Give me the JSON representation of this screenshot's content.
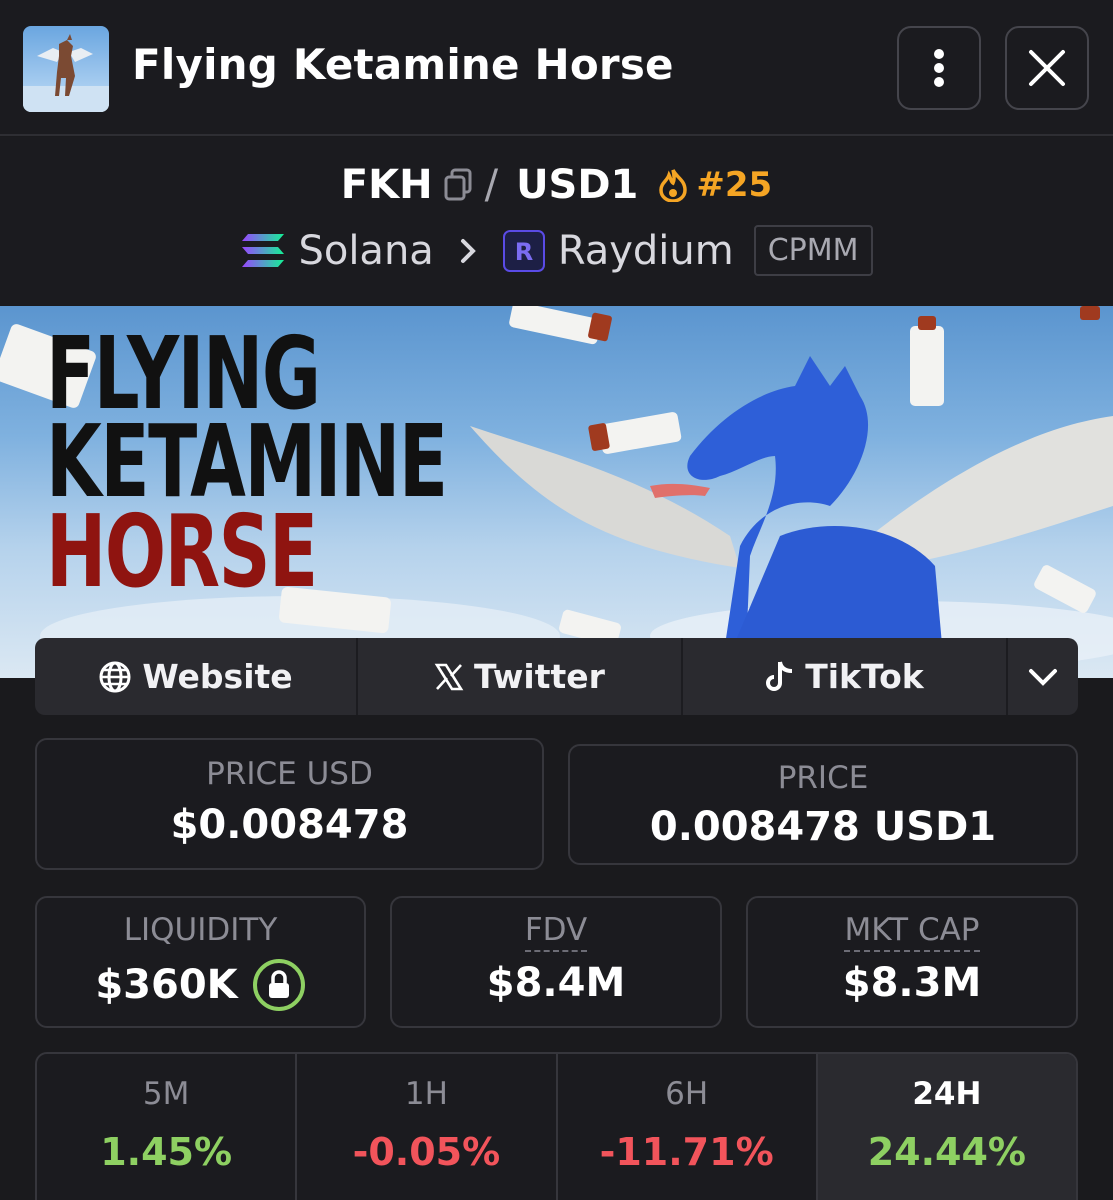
{
  "header": {
    "title": "Flying Ketamine Horse",
    "avatar_icon": "flying-horse-avatar",
    "more_icon": "vertical-dots-icon",
    "close_icon": "close-icon"
  },
  "pair": {
    "base": "FKH",
    "quote": "USD1",
    "rank": "#25",
    "chain": "Solana",
    "dex": "Raydium",
    "pool_type": "CPMM",
    "accent_color": "#f5a524"
  },
  "banner": {
    "line1": "FLYING",
    "line2": "KETAMINE",
    "line3": "HORSE"
  },
  "socials": {
    "website": "Website",
    "twitter": "Twitter",
    "tiktok": "TikTok"
  },
  "stats": {
    "price_usd_label": "PRICE USD",
    "price_usd": "$0.008478",
    "price_label": "PRICE",
    "price": "0.008478 USD1",
    "liquidity_label": "LIQUIDITY",
    "liquidity": "$360K",
    "fdv_label": "FDV",
    "fdv": "$8.4M",
    "mcap_label": "MKT CAP",
    "mcap": "$8.3M"
  },
  "changes": [
    {
      "label": "5M",
      "value": "1.45%",
      "color": "#8ed062"
    },
    {
      "label": "1H",
      "value": "-0.05%",
      "color": "#f2545b"
    },
    {
      "label": "6H",
      "value": "-11.71%",
      "color": "#f2545b"
    },
    {
      "label": "24H",
      "value": "24.44%",
      "color": "#8ed062"
    }
  ]
}
